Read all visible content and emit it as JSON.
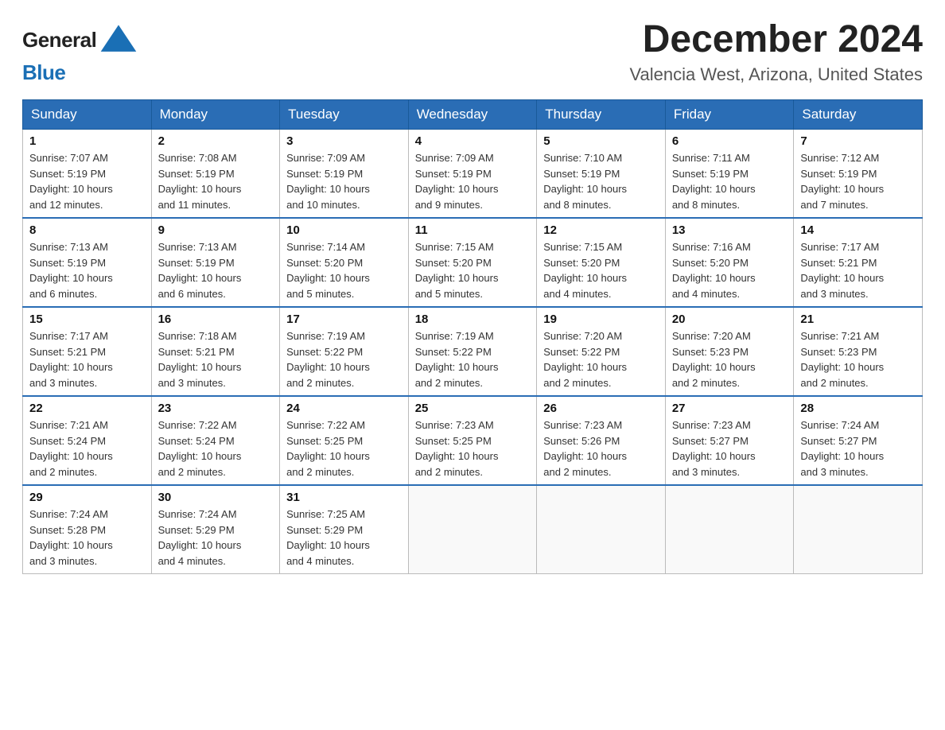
{
  "header": {
    "logo_general": "General",
    "logo_blue": "Blue",
    "title": "December 2024",
    "subtitle": "Valencia West, Arizona, United States"
  },
  "days_of_week": [
    "Sunday",
    "Monday",
    "Tuesday",
    "Wednesday",
    "Thursday",
    "Friday",
    "Saturday"
  ],
  "weeks": [
    [
      {
        "day": "1",
        "sunrise": "7:07 AM",
        "sunset": "5:19 PM",
        "daylight": "10 hours and 12 minutes."
      },
      {
        "day": "2",
        "sunrise": "7:08 AM",
        "sunset": "5:19 PM",
        "daylight": "10 hours and 11 minutes."
      },
      {
        "day": "3",
        "sunrise": "7:09 AM",
        "sunset": "5:19 PM",
        "daylight": "10 hours and 10 minutes."
      },
      {
        "day": "4",
        "sunrise": "7:09 AM",
        "sunset": "5:19 PM",
        "daylight": "10 hours and 9 minutes."
      },
      {
        "day": "5",
        "sunrise": "7:10 AM",
        "sunset": "5:19 PM",
        "daylight": "10 hours and 8 minutes."
      },
      {
        "day": "6",
        "sunrise": "7:11 AM",
        "sunset": "5:19 PM",
        "daylight": "10 hours and 8 minutes."
      },
      {
        "day": "7",
        "sunrise": "7:12 AM",
        "sunset": "5:19 PM",
        "daylight": "10 hours and 7 minutes."
      }
    ],
    [
      {
        "day": "8",
        "sunrise": "7:13 AM",
        "sunset": "5:19 PM",
        "daylight": "10 hours and 6 minutes."
      },
      {
        "day": "9",
        "sunrise": "7:13 AM",
        "sunset": "5:19 PM",
        "daylight": "10 hours and 6 minutes."
      },
      {
        "day": "10",
        "sunrise": "7:14 AM",
        "sunset": "5:20 PM",
        "daylight": "10 hours and 5 minutes."
      },
      {
        "day": "11",
        "sunrise": "7:15 AM",
        "sunset": "5:20 PM",
        "daylight": "10 hours and 5 minutes."
      },
      {
        "day": "12",
        "sunrise": "7:15 AM",
        "sunset": "5:20 PM",
        "daylight": "10 hours and 4 minutes."
      },
      {
        "day": "13",
        "sunrise": "7:16 AM",
        "sunset": "5:20 PM",
        "daylight": "10 hours and 4 minutes."
      },
      {
        "day": "14",
        "sunrise": "7:17 AM",
        "sunset": "5:21 PM",
        "daylight": "10 hours and 3 minutes."
      }
    ],
    [
      {
        "day": "15",
        "sunrise": "7:17 AM",
        "sunset": "5:21 PM",
        "daylight": "10 hours and 3 minutes."
      },
      {
        "day": "16",
        "sunrise": "7:18 AM",
        "sunset": "5:21 PM",
        "daylight": "10 hours and 3 minutes."
      },
      {
        "day": "17",
        "sunrise": "7:19 AM",
        "sunset": "5:22 PM",
        "daylight": "10 hours and 2 minutes."
      },
      {
        "day": "18",
        "sunrise": "7:19 AM",
        "sunset": "5:22 PM",
        "daylight": "10 hours and 2 minutes."
      },
      {
        "day": "19",
        "sunrise": "7:20 AM",
        "sunset": "5:22 PM",
        "daylight": "10 hours and 2 minutes."
      },
      {
        "day": "20",
        "sunrise": "7:20 AM",
        "sunset": "5:23 PM",
        "daylight": "10 hours and 2 minutes."
      },
      {
        "day": "21",
        "sunrise": "7:21 AM",
        "sunset": "5:23 PM",
        "daylight": "10 hours and 2 minutes."
      }
    ],
    [
      {
        "day": "22",
        "sunrise": "7:21 AM",
        "sunset": "5:24 PM",
        "daylight": "10 hours and 2 minutes."
      },
      {
        "day": "23",
        "sunrise": "7:22 AM",
        "sunset": "5:24 PM",
        "daylight": "10 hours and 2 minutes."
      },
      {
        "day": "24",
        "sunrise": "7:22 AM",
        "sunset": "5:25 PM",
        "daylight": "10 hours and 2 minutes."
      },
      {
        "day": "25",
        "sunrise": "7:23 AM",
        "sunset": "5:25 PM",
        "daylight": "10 hours and 2 minutes."
      },
      {
        "day": "26",
        "sunrise": "7:23 AM",
        "sunset": "5:26 PM",
        "daylight": "10 hours and 2 minutes."
      },
      {
        "day": "27",
        "sunrise": "7:23 AM",
        "sunset": "5:27 PM",
        "daylight": "10 hours and 3 minutes."
      },
      {
        "day": "28",
        "sunrise": "7:24 AM",
        "sunset": "5:27 PM",
        "daylight": "10 hours and 3 minutes."
      }
    ],
    [
      {
        "day": "29",
        "sunrise": "7:24 AM",
        "sunset": "5:28 PM",
        "daylight": "10 hours and 3 minutes."
      },
      {
        "day": "30",
        "sunrise": "7:24 AM",
        "sunset": "5:29 PM",
        "daylight": "10 hours and 4 minutes."
      },
      {
        "day": "31",
        "sunrise": "7:25 AM",
        "sunset": "5:29 PM",
        "daylight": "10 hours and 4 minutes."
      },
      null,
      null,
      null,
      null
    ]
  ],
  "labels": {
    "sunrise": "Sunrise:",
    "sunset": "Sunset:",
    "daylight": "Daylight:"
  }
}
